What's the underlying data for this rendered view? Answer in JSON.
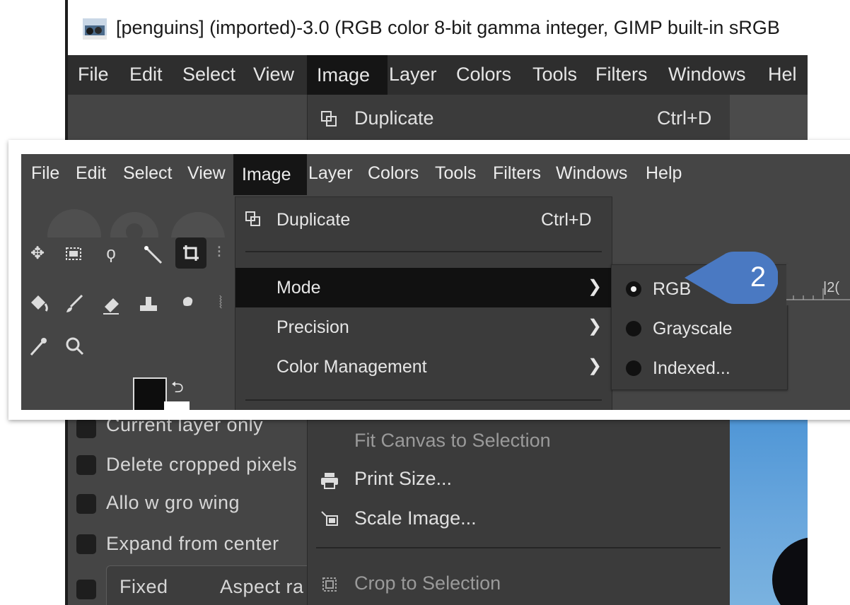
{
  "window": {
    "title": "[penguins] (imported)-3.0 (RGB color 8-bit gamma integer, GIMP built-in sRGB"
  },
  "menubar": {
    "items": [
      "File",
      "Edit",
      "Select",
      "View",
      "Image",
      "Layer",
      "Colors",
      "Tools",
      "Filters",
      "Windows",
      "Help"
    ],
    "bg_last_item_partial": "Hel",
    "active": "Image"
  },
  "image_menu": {
    "duplicate": {
      "label": "Duplicate",
      "shortcut": "Ctrl+D"
    },
    "mode": {
      "label": "Mode"
    },
    "precision": {
      "label": "Precision"
    },
    "color_management": {
      "label": "Color Management"
    },
    "fit_canvas_to_selection": {
      "label": "Fit Canvas to Selection"
    },
    "print_size": {
      "label": "Print Size..."
    },
    "scale_image": {
      "label": "Scale Image..."
    },
    "crop_to_selection": {
      "label": "Crop to Selection"
    }
  },
  "mode_submenu": {
    "selected": "RGB",
    "items": [
      "RGB",
      "Grayscale",
      "Indexed..."
    ]
  },
  "tool_options": {
    "current_layer_only": "Current layer only",
    "delete_cropped_pixels": "Delete cropped pixels",
    "allow_growing": "Allo w gro wing",
    "expand_from_center": "Expand from center",
    "fixed": "Fixed",
    "aspect_ratio_partial": "Aspect ra"
  },
  "ruler": {
    "tick_label": "|2("
  },
  "callout": {
    "step": "2"
  },
  "colors": {
    "accent_callout": "#4a79c2",
    "menu_bg": "#3b3b3b",
    "menu_highlight": "#111111",
    "window_bg": "#454545"
  },
  "icons": [
    "image-thumbnail-icon",
    "duplicate-icon",
    "chevron-right-icon",
    "radio-selected-icon",
    "radio-icon",
    "print-icon",
    "scale-icon",
    "crop-icon",
    "move-tool-icon",
    "rect-select-icon",
    "lasso-icon",
    "fuzzy-select-icon",
    "crop-tool-icon",
    "bucket-fill-icon",
    "paintbrush-icon",
    "eraser-icon",
    "clone-icon",
    "smudge-icon",
    "color-picker-icon",
    "zoom-icon",
    "swap-colors-icon"
  ]
}
